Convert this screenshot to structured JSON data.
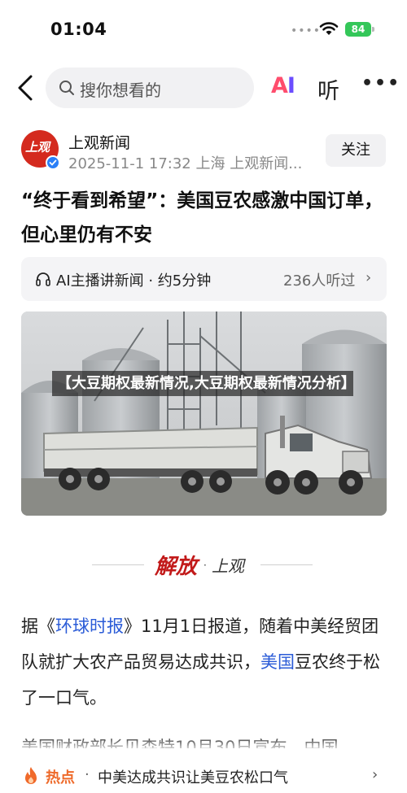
{
  "status_bar": {
    "time": "01:04",
    "signal": "••••",
    "battery": "84"
  },
  "top_nav": {
    "search_placeholder": "搜你想看的",
    "ai_label_a": "A",
    "ai_label_i": "I",
    "listen_label": "听",
    "more_label": "•••"
  },
  "author": {
    "avatar_text": "上观",
    "name": "上观新闻",
    "meta": "2025-11-1 17:32 上海 上观新闻...",
    "follow_label": "关注"
  },
  "article": {
    "headline": "“终于看到希望”：美国豆农感激中国订单，但心里仍有不安",
    "ai_news_label": "AI主播讲新闻 · 约5分钟",
    "ai_news_count": "236人听过",
    "ai_news_chevron": "›",
    "image_caption": "【大豆期权最新情况,大豆期权最新情况分析】",
    "masthead_logo": "解放",
    "masthead_dot": "·",
    "masthead_text": "上观",
    "para1_a": "据《",
    "para1_link1": "环球时报",
    "para1_b": "》11月1日报道，随着中美经贸团队就扩大农产品贸易达成共识，",
    "para1_link2": "美国",
    "para1_c": "豆农终于松了一口气。",
    "para2": "美国财政部长贝森特10月30日宣布，中国"
  },
  "hot_bar": {
    "label": "热点",
    "separator": "·",
    "text": "中美达成共识让美豆农松口气",
    "chevron": "›"
  },
  "colors": {
    "accent_red": "#d42a1e",
    "link_blue": "#2a5bd7",
    "hot_orange": "#ee6a2a",
    "battery_green": "#34c759"
  }
}
